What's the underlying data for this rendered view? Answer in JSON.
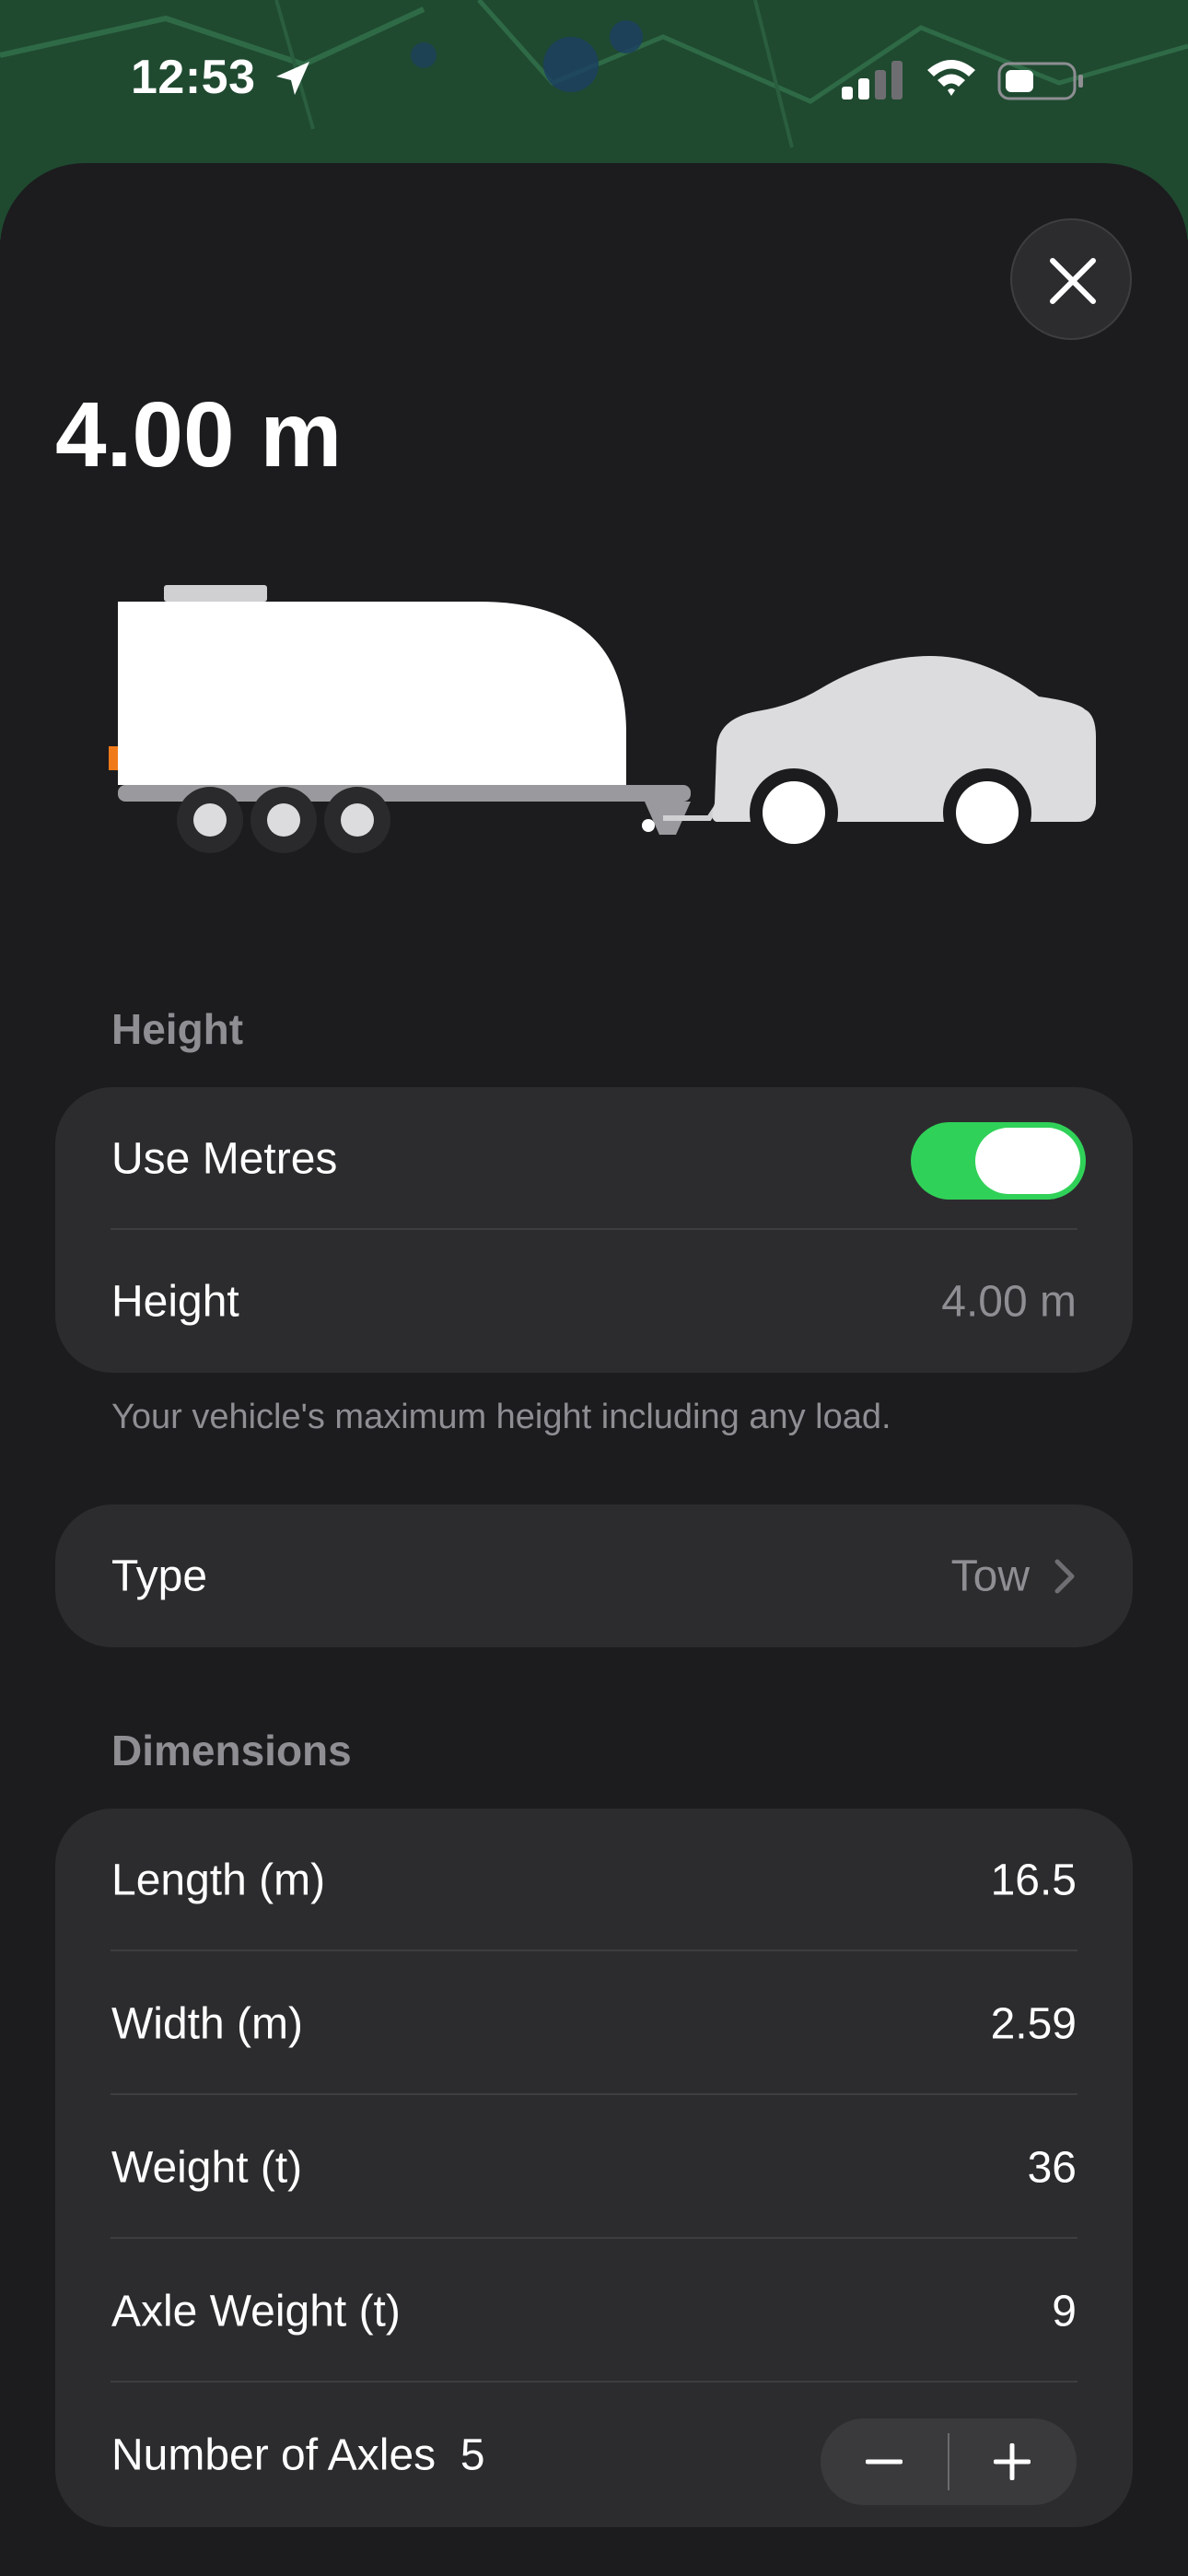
{
  "status_bar": {
    "time": "12:53"
  },
  "sheet": {
    "title": "4.00 m"
  },
  "height_section": {
    "header": "Height",
    "use_metres_label": "Use Metres",
    "use_metres_on": true,
    "height_label": "Height",
    "height_value": "4.00 m",
    "footnote": "Your vehicle's maximum height including any load."
  },
  "type_row": {
    "label": "Type",
    "value": "Tow"
  },
  "dimensions_section": {
    "header": "Dimensions",
    "rows": [
      {
        "label": "Length (m)",
        "value": "16.5"
      },
      {
        "label": "Width (m)",
        "value": "2.59"
      },
      {
        "label": "Weight (t)",
        "value": "36"
      },
      {
        "label": "Axle Weight (t)",
        "value": "9"
      }
    ],
    "axles_label": "Number of Axles",
    "axles_value": "5"
  },
  "colors": {
    "background": "#1c1c1e",
    "card": "#2c2c2e",
    "toggle_on": "#30d158",
    "secondary_text": "#8e8e93",
    "map": "#1f4a30"
  },
  "icons": {
    "close": "close-icon",
    "location": "location-arrow-icon",
    "signal": "cellular-signal-icon",
    "wifi": "wifi-icon",
    "battery": "battery-icon",
    "chevron": "chevron-right-icon",
    "minus": "minus-icon",
    "plus": "plus-icon"
  }
}
